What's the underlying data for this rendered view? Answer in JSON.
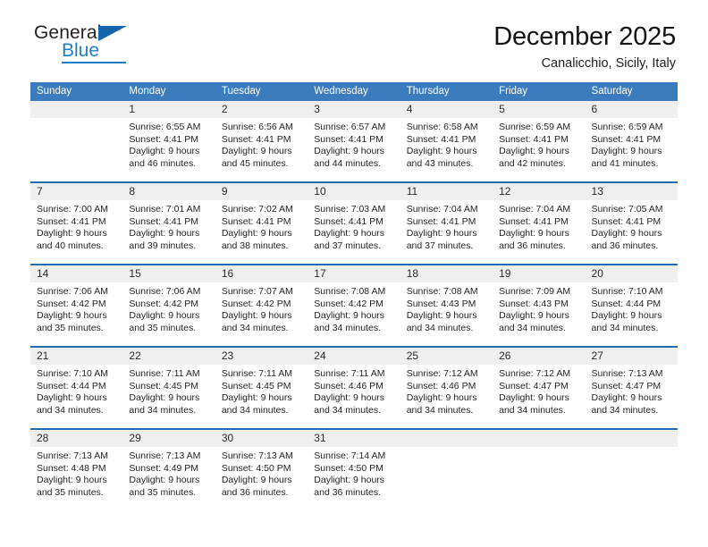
{
  "brand": {
    "name_top": "General",
    "name_bottom": "Blue",
    "triangle_color": "#1565ad",
    "blue_color": "#1f7fc4"
  },
  "header": {
    "title": "December 2025",
    "subtitle": "Canalicchio, Sicily, Italy"
  },
  "theme": {
    "header_row_bg": "#3a7cbe",
    "week_rule": "#1f6cb0",
    "daynum_band": "#efefef"
  },
  "calendar": {
    "weekday_headers": [
      "Sunday",
      "Monday",
      "Tuesday",
      "Wednesday",
      "Thursday",
      "Friday",
      "Saturday"
    ],
    "weeks": [
      [
        {
          "day": "",
          "l1": "",
          "l2": "",
          "l3": "",
          "l4": ""
        },
        {
          "day": "1",
          "l1": "Sunrise: 6:55 AM",
          "l2": "Sunset: 4:41 PM",
          "l3": "Daylight: 9 hours",
          "l4": "and 46 minutes."
        },
        {
          "day": "2",
          "l1": "Sunrise: 6:56 AM",
          "l2": "Sunset: 4:41 PM",
          "l3": "Daylight: 9 hours",
          "l4": "and 45 minutes."
        },
        {
          "day": "3",
          "l1": "Sunrise: 6:57 AM",
          "l2": "Sunset: 4:41 PM",
          "l3": "Daylight: 9 hours",
          "l4": "and 44 minutes."
        },
        {
          "day": "4",
          "l1": "Sunrise: 6:58 AM",
          "l2": "Sunset: 4:41 PM",
          "l3": "Daylight: 9 hours",
          "l4": "and 43 minutes."
        },
        {
          "day": "5",
          "l1": "Sunrise: 6:59 AM",
          "l2": "Sunset: 4:41 PM",
          "l3": "Daylight: 9 hours",
          "l4": "and 42 minutes."
        },
        {
          "day": "6",
          "l1": "Sunrise: 6:59 AM",
          "l2": "Sunset: 4:41 PM",
          "l3": "Daylight: 9 hours",
          "l4": "and 41 minutes."
        }
      ],
      [
        {
          "day": "7",
          "l1": "Sunrise: 7:00 AM",
          "l2": "Sunset: 4:41 PM",
          "l3": "Daylight: 9 hours",
          "l4": "and 40 minutes."
        },
        {
          "day": "8",
          "l1": "Sunrise: 7:01 AM",
          "l2": "Sunset: 4:41 PM",
          "l3": "Daylight: 9 hours",
          "l4": "and 39 minutes."
        },
        {
          "day": "9",
          "l1": "Sunrise: 7:02 AM",
          "l2": "Sunset: 4:41 PM",
          "l3": "Daylight: 9 hours",
          "l4": "and 38 minutes."
        },
        {
          "day": "10",
          "l1": "Sunrise: 7:03 AM",
          "l2": "Sunset: 4:41 PM",
          "l3": "Daylight: 9 hours",
          "l4": "and 37 minutes."
        },
        {
          "day": "11",
          "l1": "Sunrise: 7:04 AM",
          "l2": "Sunset: 4:41 PM",
          "l3": "Daylight: 9 hours",
          "l4": "and 37 minutes."
        },
        {
          "day": "12",
          "l1": "Sunrise: 7:04 AM",
          "l2": "Sunset: 4:41 PM",
          "l3": "Daylight: 9 hours",
          "l4": "and 36 minutes."
        },
        {
          "day": "13",
          "l1": "Sunrise: 7:05 AM",
          "l2": "Sunset: 4:41 PM",
          "l3": "Daylight: 9 hours",
          "l4": "and 36 minutes."
        }
      ],
      [
        {
          "day": "14",
          "l1": "Sunrise: 7:06 AM",
          "l2": "Sunset: 4:42 PM",
          "l3": "Daylight: 9 hours",
          "l4": "and 35 minutes."
        },
        {
          "day": "15",
          "l1": "Sunrise: 7:06 AM",
          "l2": "Sunset: 4:42 PM",
          "l3": "Daylight: 9 hours",
          "l4": "and 35 minutes."
        },
        {
          "day": "16",
          "l1": "Sunrise: 7:07 AM",
          "l2": "Sunset: 4:42 PM",
          "l3": "Daylight: 9 hours",
          "l4": "and 34 minutes."
        },
        {
          "day": "17",
          "l1": "Sunrise: 7:08 AM",
          "l2": "Sunset: 4:42 PM",
          "l3": "Daylight: 9 hours",
          "l4": "and 34 minutes."
        },
        {
          "day": "18",
          "l1": "Sunrise: 7:08 AM",
          "l2": "Sunset: 4:43 PM",
          "l3": "Daylight: 9 hours",
          "l4": "and 34 minutes."
        },
        {
          "day": "19",
          "l1": "Sunrise: 7:09 AM",
          "l2": "Sunset: 4:43 PM",
          "l3": "Daylight: 9 hours",
          "l4": "and 34 minutes."
        },
        {
          "day": "20",
          "l1": "Sunrise: 7:10 AM",
          "l2": "Sunset: 4:44 PM",
          "l3": "Daylight: 9 hours",
          "l4": "and 34 minutes."
        }
      ],
      [
        {
          "day": "21",
          "l1": "Sunrise: 7:10 AM",
          "l2": "Sunset: 4:44 PM",
          "l3": "Daylight: 9 hours",
          "l4": "and 34 minutes."
        },
        {
          "day": "22",
          "l1": "Sunrise: 7:11 AM",
          "l2": "Sunset: 4:45 PM",
          "l3": "Daylight: 9 hours",
          "l4": "and 34 minutes."
        },
        {
          "day": "23",
          "l1": "Sunrise: 7:11 AM",
          "l2": "Sunset: 4:45 PM",
          "l3": "Daylight: 9 hours",
          "l4": "and 34 minutes."
        },
        {
          "day": "24",
          "l1": "Sunrise: 7:11 AM",
          "l2": "Sunset: 4:46 PM",
          "l3": "Daylight: 9 hours",
          "l4": "and 34 minutes."
        },
        {
          "day": "25",
          "l1": "Sunrise: 7:12 AM",
          "l2": "Sunset: 4:46 PM",
          "l3": "Daylight: 9 hours",
          "l4": "and 34 minutes."
        },
        {
          "day": "26",
          "l1": "Sunrise: 7:12 AM",
          "l2": "Sunset: 4:47 PM",
          "l3": "Daylight: 9 hours",
          "l4": "and 34 minutes."
        },
        {
          "day": "27",
          "l1": "Sunrise: 7:13 AM",
          "l2": "Sunset: 4:47 PM",
          "l3": "Daylight: 9 hours",
          "l4": "and 34 minutes."
        }
      ],
      [
        {
          "day": "28",
          "l1": "Sunrise: 7:13 AM",
          "l2": "Sunset: 4:48 PM",
          "l3": "Daylight: 9 hours",
          "l4": "and 35 minutes."
        },
        {
          "day": "29",
          "l1": "Sunrise: 7:13 AM",
          "l2": "Sunset: 4:49 PM",
          "l3": "Daylight: 9 hours",
          "l4": "and 35 minutes."
        },
        {
          "day": "30",
          "l1": "Sunrise: 7:13 AM",
          "l2": "Sunset: 4:50 PM",
          "l3": "Daylight: 9 hours",
          "l4": "and 36 minutes."
        },
        {
          "day": "31",
          "l1": "Sunrise: 7:14 AM",
          "l2": "Sunset: 4:50 PM",
          "l3": "Daylight: 9 hours",
          "l4": "and 36 minutes."
        },
        {
          "day": "",
          "l1": "",
          "l2": "",
          "l3": "",
          "l4": ""
        },
        {
          "day": "",
          "l1": "",
          "l2": "",
          "l3": "",
          "l4": ""
        },
        {
          "day": "",
          "l1": "",
          "l2": "",
          "l3": "",
          "l4": ""
        }
      ]
    ]
  }
}
